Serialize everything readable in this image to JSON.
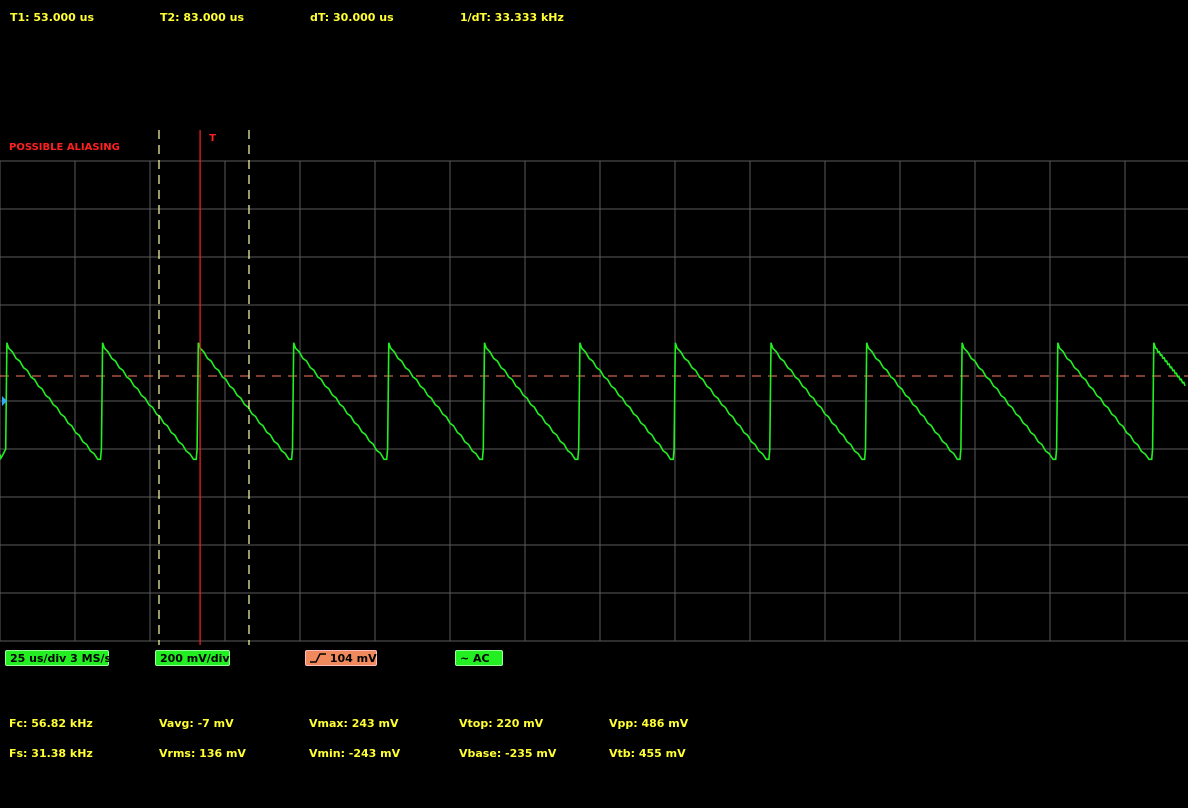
{
  "cursors": {
    "t1": "T1: 53.000 us",
    "t2": "T2: 83.000 us",
    "dt": "dT: 30.000 us",
    "inv_dt": "1/dT: 33.333 kHz"
  },
  "warning": "POSSIBLE ALIASING",
  "trigger_marker": "T",
  "settings": {
    "timebase": "25 us/div 3 MS/s",
    "vdiv": "200 mV/div",
    "trigger_level": "104 mV",
    "trigger_icon": "rising-edge-icon",
    "coupling": "~ AC"
  },
  "measurements": {
    "fc": "Fc: 56.82 kHz",
    "fs": "Fs: 31.38 kHz",
    "vavg": "Vavg: -7 mV",
    "vrms": "Vrms: 136 mV",
    "vmax": "Vmax: 243 mV",
    "vmin": "Vmin: -243 mV",
    "vtop": "Vtop: 220 mV",
    "vbase": "Vbase: -235 mV",
    "vpp": "Vpp: 486 mV",
    "vtb": "Vtb: 455 mV"
  },
  "colors": {
    "background": "#000000",
    "grid": "#5a5a5a",
    "trace": "#22ee22",
    "text": "#ffff33",
    "trigger": "#ff2020",
    "cursor": "#ffffaa"
  },
  "chart_data": {
    "type": "line",
    "title": "",
    "xlabel": "",
    "ylabel": "",
    "x_unit": "us",
    "y_unit": "mV",
    "xlim": [
      0,
      395
    ],
    "ylim": [
      -800,
      800
    ],
    "series": [
      {
        "waveform": "sawtooth",
        "frequency_khz": 31.38,
        "vmax_mv": 243,
        "vmin_mv": -243,
        "period_starts_us": [
          1.9,
          33.8,
          65.7,
          97.5,
          129.2,
          161.1,
          192.9,
          224.7,
          256.6,
          288.5,
          320.3,
          352.2,
          384.2
        ]
      }
    ],
    "trigger_level_mv": 104,
    "trigger_time_us": 66.7,
    "cursor_times_us": [
      53.0,
      83.0
    ]
  }
}
